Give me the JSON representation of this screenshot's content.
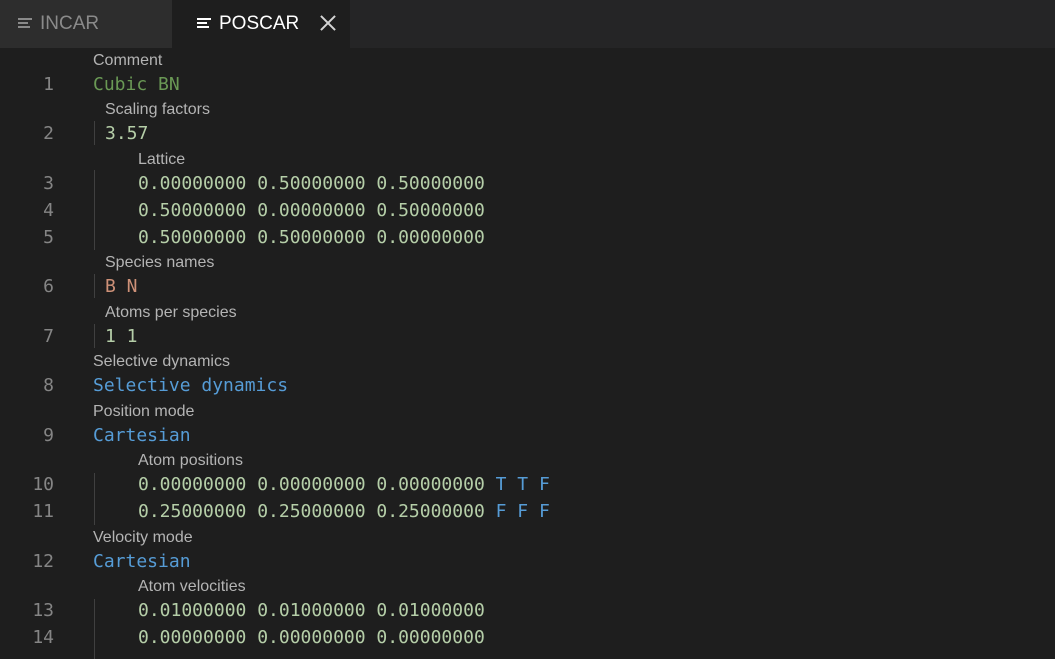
{
  "tabs": [
    {
      "label": "INCAR",
      "icon": "file-lines-icon",
      "active": false
    },
    {
      "label": "POSCAR",
      "icon": "file-lines-icon",
      "active": true
    }
  ],
  "hints": {
    "comment": "Comment",
    "scaling": "Scaling factors",
    "lattice": "Lattice",
    "species": "Species names",
    "atoms_per_species": "Atoms per species",
    "selective_dynamics": "Selective dynamics",
    "position_mode": "Position mode",
    "atom_positions": "Atom positions",
    "velocity_mode": "Velocity mode",
    "atom_velocities": "Atom velocities"
  },
  "lines": {
    "l1": {
      "num": "1",
      "text": "Cubic BN"
    },
    "l2": {
      "num": "2",
      "text": "3.57"
    },
    "l3": {
      "num": "3",
      "text": "0.00000000 0.50000000 0.50000000"
    },
    "l4": {
      "num": "4",
      "text": "0.50000000 0.00000000 0.50000000"
    },
    "l5": {
      "num": "5",
      "text": "0.50000000 0.50000000 0.00000000"
    },
    "l6": {
      "num": "6",
      "text": "B N"
    },
    "l7": {
      "num": "7",
      "text": "1 1"
    },
    "l8": {
      "num": "8",
      "text": "Selective dynamics"
    },
    "l9": {
      "num": "9",
      "text": "Cartesian"
    },
    "l10": {
      "num": "10",
      "text": "0.00000000 0.00000000 0.00000000",
      "flags": "T T F"
    },
    "l11": {
      "num": "11",
      "text": "0.25000000 0.25000000 0.25000000",
      "flags": "F F F"
    },
    "l12": {
      "num": "12",
      "text": "Cartesian"
    },
    "l13": {
      "num": "13",
      "text": "0.01000000 0.01000000 0.01000000"
    },
    "l14": {
      "num": "14",
      "text": "0.00000000 0.00000000 0.00000000"
    }
  },
  "colors": {
    "comment": "#6a9955",
    "number": "#b5cea8",
    "species": "#ce9178",
    "keyword": "#569cd6"
  }
}
